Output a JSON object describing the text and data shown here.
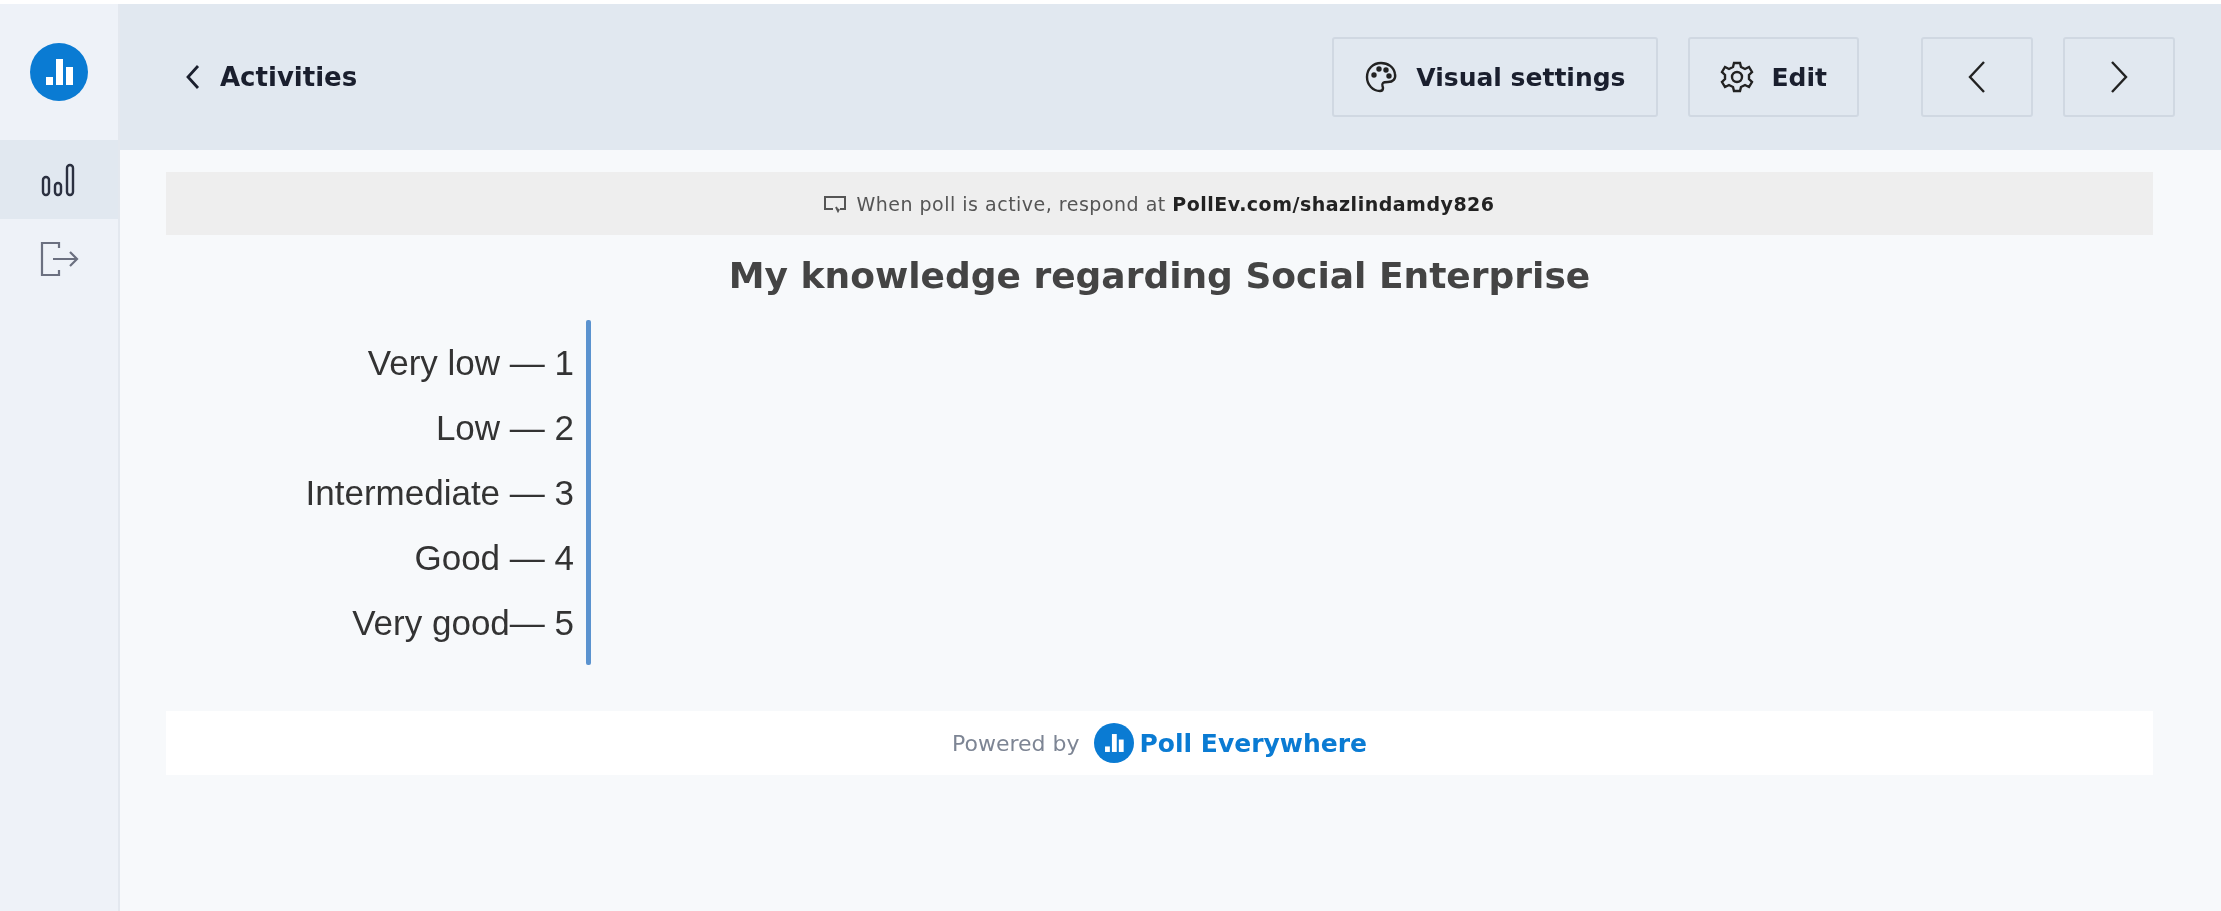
{
  "sidebar": {
    "items": [
      {
        "kind": "results",
        "selected": true
      },
      {
        "kind": "exit",
        "selected": false
      }
    ]
  },
  "header": {
    "back_link": "Activities",
    "buttons": [
      {
        "kind": "palette",
        "label": "Visual settings"
      },
      {
        "kind": "gear",
        "label": "Edit"
      },
      {
        "kind": "prev"
      },
      {
        "kind": "next"
      }
    ]
  },
  "banner": {
    "text": "When poll is active, respond at **PollEv.com/shazlindamdy826**"
  },
  "poll": {
    "title": "My knowledge regarding Social Enterprise",
    "options": [
      "Very low — 1",
      "Low — 2",
      "Intermediate — 3",
      "Good — 4",
      "Very good— 5"
    ]
  },
  "footer": {
    "powered_by": "Powered by",
    "brand": "Poll Everywhere"
  }
}
